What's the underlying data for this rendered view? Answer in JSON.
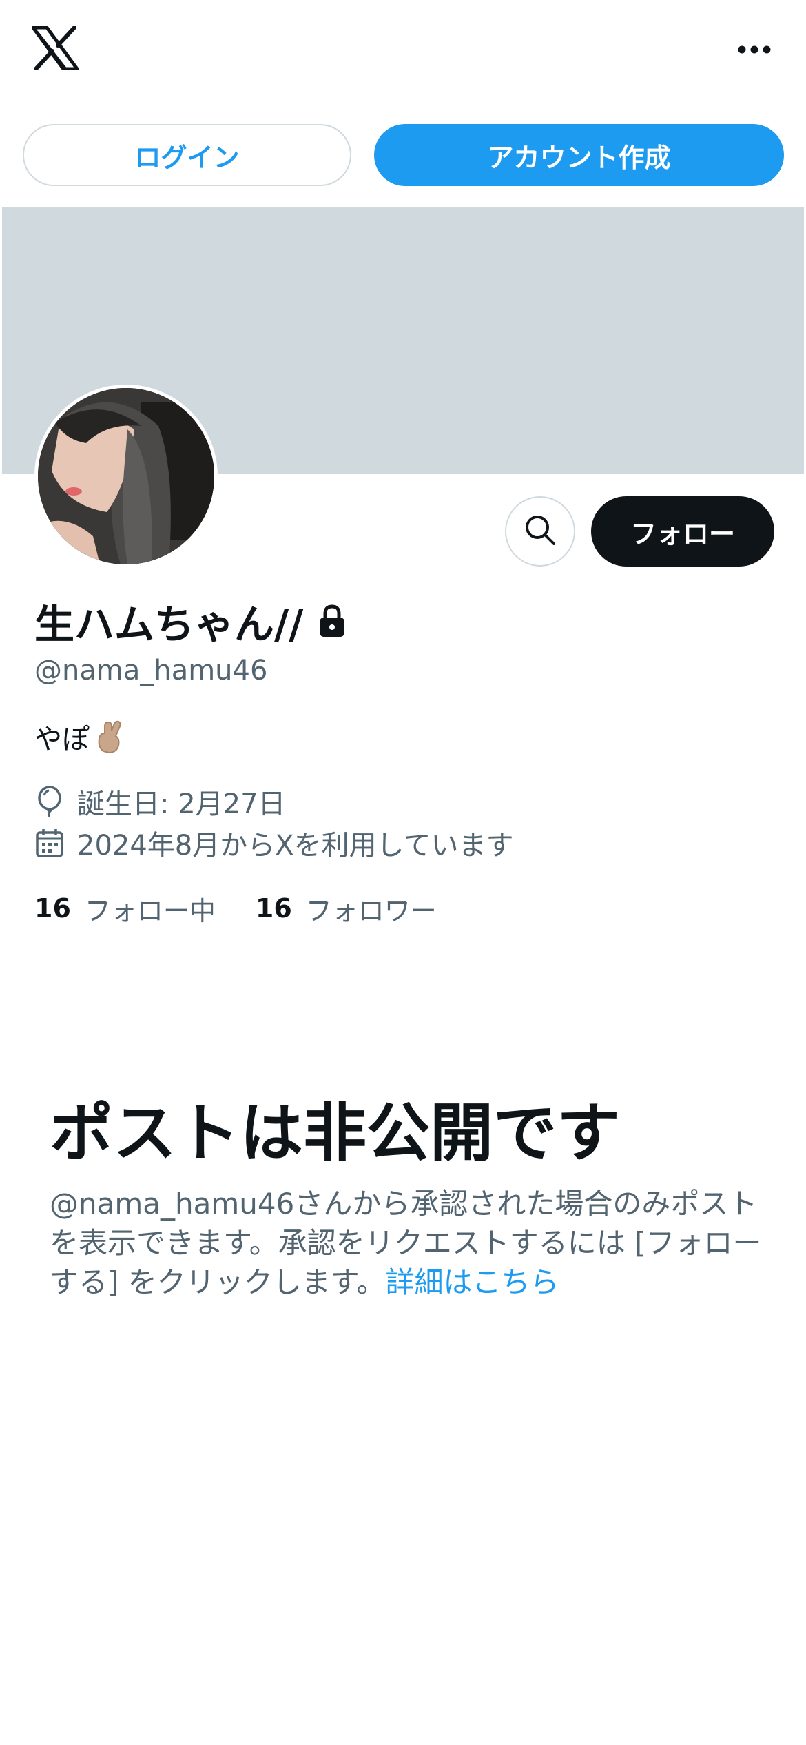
{
  "header": {
    "logo_icon": "x-logo-icon",
    "more_icon": "more-dots-icon"
  },
  "auth": {
    "login_label": "ログイン",
    "signup_label": "アカウント作成"
  },
  "profile": {
    "display_name": "生ハムちゃん//",
    "handle": "@nama_hamu46",
    "bio": "やぽ",
    "bio_emoji": "crossed-fingers-emoji",
    "birthday": "誕生日: 2月27日",
    "joined": "2024年8月からXを利用しています",
    "following_count": "16",
    "following_label": "フォロー中",
    "followers_count": "16",
    "followers_label": "フォロワー",
    "follow_label": "フォロー",
    "protected_icon": "lock-icon"
  },
  "private_notice": {
    "title": "ポストは非公開です",
    "body": "@nama_hamu46さんから承認された場合のみポストを表示できます。承認をリクエストするには [フォローする] をクリックします。",
    "link_label": "詳細はこちら"
  },
  "colors": {
    "accent": "#1d9bf0",
    "text_primary": "#0f1419",
    "text_secondary": "#536471",
    "banner": "#cfd9de"
  }
}
